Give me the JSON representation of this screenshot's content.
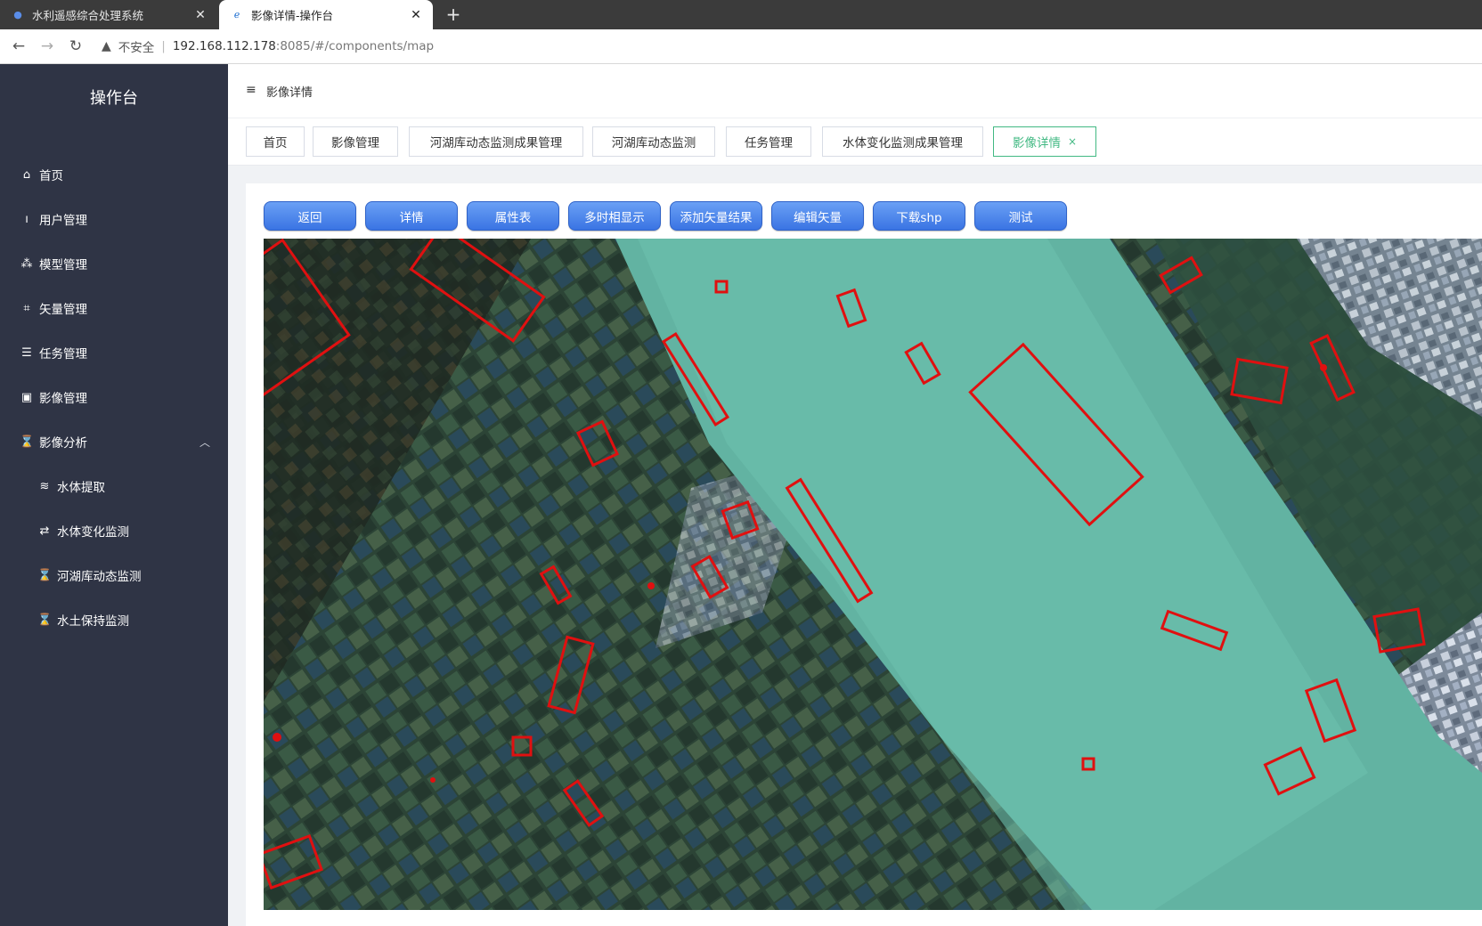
{
  "browser": {
    "tabs": [
      {
        "title": "水利遥感综合处理系统",
        "close": "✕"
      },
      {
        "title": "影像详情-操作台",
        "close": "✕"
      }
    ],
    "new_tab": "+",
    "address": {
      "insecure_label": "不安全",
      "host": "192.168.112.178",
      "rest": ":8085/#/components/map"
    }
  },
  "sidebar": {
    "title": "操作台",
    "items": [
      {
        "label": "首页",
        "icon": "home-icon"
      },
      {
        "label": "用户管理",
        "icon": "user-icon"
      },
      {
        "label": "模型管理",
        "icon": "model-icon"
      },
      {
        "label": "矢量管理",
        "icon": "vector-icon"
      },
      {
        "label": "任务管理",
        "icon": "task-list-icon"
      },
      {
        "label": "影像管理",
        "icon": "image-icon"
      },
      {
        "label": "影像分析",
        "icon": "hourglass-icon",
        "expanded": true
      }
    ],
    "subitems": [
      {
        "label": "水体提取",
        "icon": "water-icon"
      },
      {
        "label": "水体变化监测",
        "icon": "exchange-icon"
      },
      {
        "label": "河湖库动态监测",
        "icon": "hourglass-icon"
      },
      {
        "label": "水土保持监测",
        "icon": "hourglass-icon"
      }
    ]
  },
  "header": {
    "breadcrumb": "影像详情"
  },
  "tags": [
    {
      "label": "首页"
    },
    {
      "label": "影像管理"
    },
    {
      "label": "河湖库动态监测成果管理"
    },
    {
      "label": "河湖库动态监测"
    },
    {
      "label": "任务管理"
    },
    {
      "label": "水体变化监测成果管理"
    },
    {
      "label": "影像详情",
      "active": true,
      "close": "×"
    }
  ],
  "toolbar": {
    "buttons": [
      {
        "label": "返回"
      },
      {
        "label": "详情"
      },
      {
        "label": "属性表"
      },
      {
        "label": "多时相显示"
      },
      {
        "label": "添加矢量结果"
      },
      {
        "label": "编辑矢量"
      },
      {
        "label": "下载shp"
      },
      {
        "label": "测试"
      }
    ]
  },
  "colors": {
    "sidebar_bg": "#2f3445",
    "active_tag": "#42b983",
    "button": "#3a74e3",
    "vector_outline": "#e01010",
    "river": "#62b3a2"
  }
}
